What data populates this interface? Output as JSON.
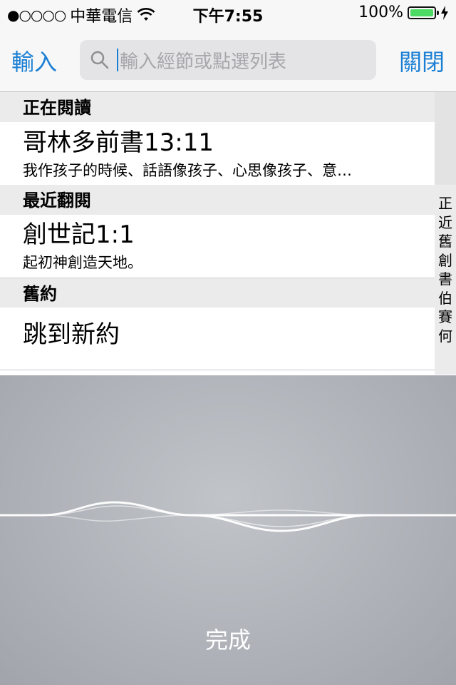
{
  "status_bar": {
    "signal_dots": "●○○○○",
    "carrier": "中華電信",
    "time": "下午7:55",
    "battery_percent": "100%",
    "battery_level": 1.0,
    "icons": [
      "wifi-icon",
      "battery-icon",
      "charging-bolt-icon"
    ]
  },
  "nav": {
    "left_button": "輸入",
    "right_button": "關閉",
    "search_placeholder": "輸入經節或點選列表"
  },
  "sections": [
    {
      "header": "正在閱讀",
      "title": "哥林多前書13:11",
      "subtitle": "我作孩子的時候、話語像孩子、心思像孩子、意…"
    },
    {
      "header": "最近翻閱",
      "title": "創世記1:1",
      "subtitle": "起初神創造天地。"
    },
    {
      "header": "舊約",
      "title": "跳到新約",
      "subtitle": ""
    }
  ],
  "index_items": [
    "正",
    "近",
    "舊",
    "創",
    "書",
    "伯",
    "賽",
    "何"
  ],
  "voice": {
    "done_label": "完成"
  },
  "colors": {
    "accent": "#1a7fd4",
    "battery_green": "#4cd964"
  }
}
